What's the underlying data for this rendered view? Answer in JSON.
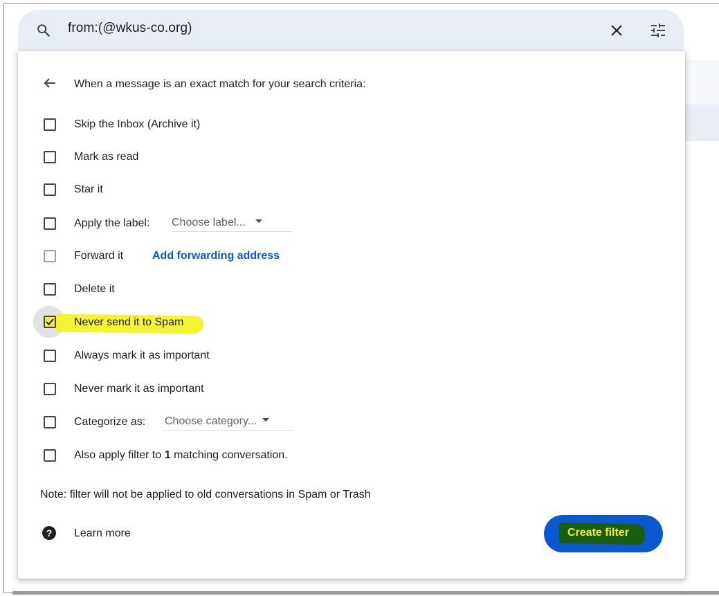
{
  "search": {
    "query": "from:(@wkus-co.org)",
    "icon": "search-icon",
    "clear_icon": "close-icon",
    "options_icon": "tune-icon"
  },
  "filter_panel": {
    "header": "When a message is an exact match for your search criteria:",
    "options": [
      {
        "label": "Skip the Inbox (Archive it)",
        "checked": false
      },
      {
        "label": "Mark as read",
        "checked": false
      },
      {
        "label": "Star it",
        "checked": false
      },
      {
        "label": "Apply the label:",
        "checked": false,
        "select": "Choose label..."
      },
      {
        "label": "Forward it",
        "checked": false,
        "disabled": true,
        "link": "Add forwarding address"
      },
      {
        "label": "Delete it",
        "checked": false
      },
      {
        "label": "Never send it to Spam",
        "checked": true,
        "highlighted": true
      },
      {
        "label": "Always mark it as important",
        "checked": false
      },
      {
        "label": "Never mark it as important",
        "checked": false
      },
      {
        "label": "Categorize as:",
        "checked": false,
        "select": "Choose category..."
      },
      {
        "label_prefix": "Also apply filter to ",
        "label_bold": "1",
        "label_suffix": " matching conversation.",
        "checked": false
      }
    ],
    "note": "Note: filter will not be applied to old conversations in Spam or Trash",
    "learn_more": "Learn more",
    "create_button": "Create filter"
  },
  "colors": {
    "accent": "#0b57d0",
    "highlight_yellow": "#f6f22a",
    "highlight_green": "#1a5e12",
    "search_bg": "#e9eef6"
  }
}
